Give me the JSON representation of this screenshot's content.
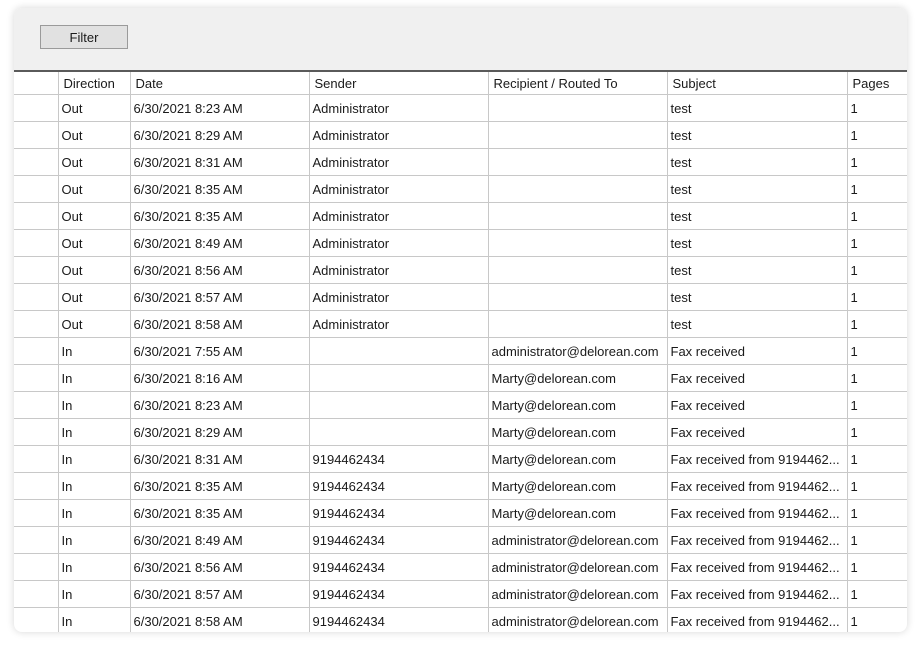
{
  "toolbar": {
    "filter_label": "Filter"
  },
  "grid": {
    "columns": [
      "Direction",
      "Date",
      "Sender",
      "Recipient / Routed To",
      "Subject",
      "Pages"
    ],
    "rows": [
      {
        "direction": "Out",
        "date": "6/30/2021 8:23 AM",
        "sender": "Administrator",
        "recipient": "",
        "subject": "test",
        "pages": "1"
      },
      {
        "direction": "Out",
        "date": "6/30/2021 8:29 AM",
        "sender": "Administrator",
        "recipient": "",
        "subject": "test",
        "pages": "1"
      },
      {
        "direction": "Out",
        "date": "6/30/2021 8:31 AM",
        "sender": "Administrator",
        "recipient": "",
        "subject": "test",
        "pages": "1"
      },
      {
        "direction": "Out",
        "date": "6/30/2021 8:35 AM",
        "sender": "Administrator",
        "recipient": "",
        "subject": "test",
        "pages": "1"
      },
      {
        "direction": "Out",
        "date": "6/30/2021 8:35 AM",
        "sender": "Administrator",
        "recipient": "",
        "subject": "test",
        "pages": "1"
      },
      {
        "direction": "Out",
        "date": "6/30/2021 8:49 AM",
        "sender": "Administrator",
        "recipient": "",
        "subject": "test",
        "pages": "1"
      },
      {
        "direction": "Out",
        "date": "6/30/2021 8:56 AM",
        "sender": "Administrator",
        "recipient": "",
        "subject": "test",
        "pages": "1"
      },
      {
        "direction": "Out",
        "date": "6/30/2021 8:57 AM",
        "sender": "Administrator",
        "recipient": "",
        "subject": "test",
        "pages": "1"
      },
      {
        "direction": "Out",
        "date": "6/30/2021 8:58 AM",
        "sender": "Administrator",
        "recipient": "",
        "subject": "test",
        "pages": "1"
      },
      {
        "direction": "In",
        "date": "6/30/2021 7:55 AM",
        "sender": "",
        "recipient": "administrator@delorean.com",
        "subject": "Fax received",
        "pages": "1"
      },
      {
        "direction": "In",
        "date": "6/30/2021 8:16 AM",
        "sender": "",
        "recipient": "Marty@delorean.com",
        "subject": "Fax received",
        "pages": "1"
      },
      {
        "direction": "In",
        "date": "6/30/2021 8:23 AM",
        "sender": "",
        "recipient": "Marty@delorean.com",
        "subject": "Fax received",
        "pages": "1"
      },
      {
        "direction": "In",
        "date": "6/30/2021 8:29 AM",
        "sender": "",
        "recipient": "Marty@delorean.com",
        "subject": "Fax received",
        "pages": "1"
      },
      {
        "direction": "In",
        "date": "6/30/2021 8:31 AM",
        "sender": "9194462434",
        "recipient": "Marty@delorean.com",
        "subject": "Fax received from 9194462...",
        "pages": "1"
      },
      {
        "direction": "In",
        "date": "6/30/2021 8:35 AM",
        "sender": "9194462434",
        "recipient": "Marty@delorean.com",
        "subject": "Fax received from 9194462...",
        "pages": "1"
      },
      {
        "direction": "In",
        "date": "6/30/2021 8:35 AM",
        "sender": "9194462434",
        "recipient": "Marty@delorean.com",
        "subject": "Fax received from 9194462...",
        "pages": "1"
      },
      {
        "direction": "In",
        "date": "6/30/2021 8:49 AM",
        "sender": "9194462434",
        "recipient": "administrator@delorean.com",
        "subject": "Fax received from 9194462...",
        "pages": "1"
      },
      {
        "direction": "In",
        "date": "6/30/2021 8:56 AM",
        "sender": "9194462434",
        "recipient": "administrator@delorean.com",
        "subject": "Fax received from 9194462...",
        "pages": "1"
      },
      {
        "direction": "In",
        "date": "6/30/2021 8:57 AM",
        "sender": "9194462434",
        "recipient": "administrator@delorean.com",
        "subject": "Fax received from 9194462...",
        "pages": "1"
      },
      {
        "direction": "In",
        "date": "6/30/2021 8:58 AM",
        "sender": "9194462434",
        "recipient": "administrator@delorean.com",
        "subject": "Fax received from 9194462...",
        "pages": "1"
      }
    ]
  }
}
